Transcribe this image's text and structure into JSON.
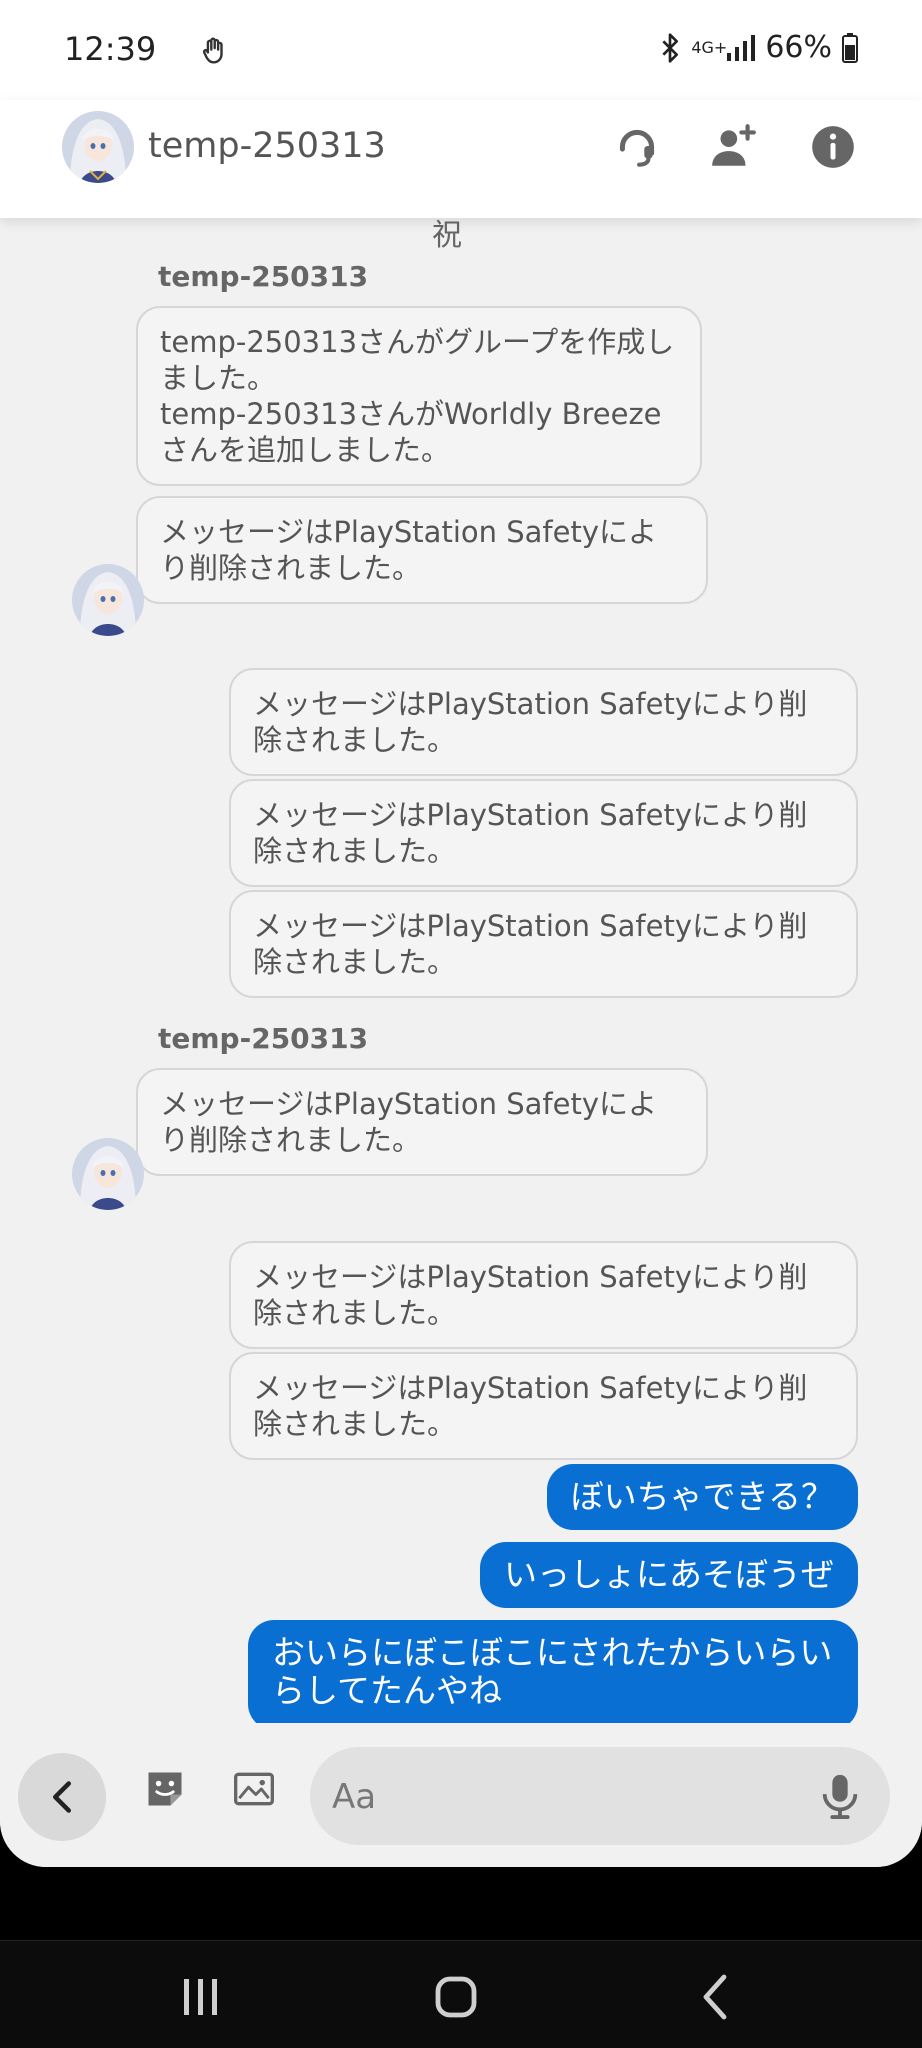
{
  "status": {
    "time": "12:39",
    "network": "4G+",
    "battery": "66%"
  },
  "header": {
    "title": "temp-250313"
  },
  "messages": {
    "partial_top": "祝",
    "sender1": "temp-250313",
    "system_msg": "temp-250313さんがグループを作成しました。\ntemp-250313さんがWorldly Breezeさんを追加しました。",
    "in_deleted_1": "メッセージはPlayStation Safetyにより削除されました。",
    "out_deleted_1": "メッセージはPlayStation Safetyにより削除されました。",
    "out_deleted_2": "メッセージはPlayStation Safetyにより削除されました。",
    "out_deleted_3": "メッセージはPlayStation Safetyにより削除されました。",
    "sender2": "temp-250313",
    "in_deleted_2": "メッセージはPlayStation Safetyにより削除されました。",
    "out_deleted_4": "メッセージはPlayStation Safetyにより削除されました。",
    "out_deleted_5": "メッセージはPlayStation Safetyにより削除されました。",
    "out_blue_1": "ぼいちゃできる？",
    "out_blue_2": "いっしょにあそぼうぜ",
    "out_blue_3": "おいらにぼこぼこにされたからいらいらしてたんやね"
  },
  "composer": {
    "placeholder": "Aa"
  },
  "colors": {
    "accent_blue": "#0a6fd3",
    "bubble_gray": "#f4f4f4",
    "background": "#f1f1f1"
  },
  "icons": {
    "header": [
      "headset-icon",
      "add-user-icon",
      "info-icon"
    ],
    "composer": [
      "back-chevron-icon",
      "sticker-icon",
      "image-icon",
      "mic-icon"
    ],
    "nav": [
      "recents-icon",
      "home-icon",
      "back-icon"
    ]
  }
}
